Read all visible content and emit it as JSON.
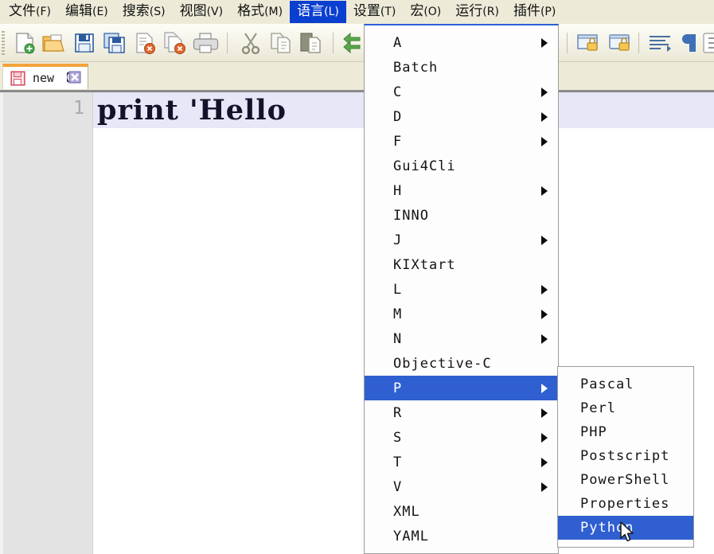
{
  "menubar": {
    "items": [
      {
        "label": "文件",
        "key": "(F)",
        "active": false,
        "name": "menu-file"
      },
      {
        "label": "编辑",
        "key": "(E)",
        "active": false,
        "name": "menu-edit"
      },
      {
        "label": "搜索",
        "key": "(S)",
        "active": false,
        "name": "menu-search"
      },
      {
        "label": "视图",
        "key": "(V)",
        "active": false,
        "name": "menu-view"
      },
      {
        "label": "格式",
        "key": "(M)",
        "active": false,
        "name": "menu-format"
      },
      {
        "label": "语言",
        "key": "(L)",
        "active": true,
        "name": "menu-language"
      },
      {
        "label": "设置",
        "key": "(T)",
        "active": false,
        "name": "menu-settings"
      },
      {
        "label": "宏",
        "key": "(O)",
        "active": false,
        "name": "menu-macro"
      },
      {
        "label": "运行",
        "key": "(R)",
        "active": false,
        "name": "menu-run"
      },
      {
        "label": "插件",
        "key": "(P)",
        "active": false,
        "name": "menu-plugins"
      }
    ]
  },
  "toolbar": {
    "icons": [
      "new-file-icon",
      "open-folder-icon",
      "save-icon",
      "save-all-icon",
      "close-file-icon",
      "close-all-icon",
      "print-icon",
      "cut-icon",
      "copy-icon",
      "paste-icon",
      "undo-icon",
      "zoom-in-lock-icon",
      "zoom-out-lock-icon",
      "word-wrap-icon",
      "show-paragraph-icon",
      "show-all-chars-icon"
    ]
  },
  "tabs": [
    {
      "label": "new",
      "icon": "unsaved-file-icon",
      "close": "close-tab-icon",
      "active": true
    }
  ],
  "editor": {
    "line_number": "1",
    "code": "print 'Hello"
  },
  "language_menu": {
    "items": [
      {
        "label": "A",
        "submenu": true
      },
      {
        "label": "Batch",
        "submenu": false
      },
      {
        "label": "C",
        "submenu": true
      },
      {
        "label": "D",
        "submenu": true
      },
      {
        "label": "F",
        "submenu": true
      },
      {
        "label": "Gui4Cli",
        "submenu": false
      },
      {
        "label": "H",
        "submenu": true
      },
      {
        "label": "INNO",
        "submenu": false
      },
      {
        "label": "J",
        "submenu": true
      },
      {
        "label": "KIXtart",
        "submenu": false
      },
      {
        "label": "L",
        "submenu": true
      },
      {
        "label": "M",
        "submenu": true
      },
      {
        "label": "N",
        "submenu": true
      },
      {
        "label": "Objective-C",
        "submenu": false
      },
      {
        "label": "P",
        "submenu": true,
        "selected": true
      },
      {
        "label": "R",
        "submenu": true
      },
      {
        "label": "S",
        "submenu": true
      },
      {
        "label": "T",
        "submenu": true
      },
      {
        "label": "V",
        "submenu": true
      },
      {
        "label": "XML",
        "submenu": false
      },
      {
        "label": "YAML",
        "submenu": false
      }
    ]
  },
  "p_submenu": {
    "items": [
      {
        "label": "Pascal",
        "selected": false
      },
      {
        "label": "Perl",
        "selected": false
      },
      {
        "label": "PHP",
        "selected": false
      },
      {
        "label": "Postscript",
        "selected": false
      },
      {
        "label": "PowerShell",
        "selected": false
      },
      {
        "label": "Properties",
        "selected": false
      },
      {
        "label": "Python",
        "selected": true
      }
    ]
  },
  "colors": {
    "menubar_bg": "#edebd8",
    "highlight_blue": "#2f5fd0",
    "menubar_active": "#0a3fd0",
    "tab_accent": "#f2a33c",
    "gutter_bg": "#e3e3e3",
    "current_line": "#e7e7f7"
  },
  "cursor": {
    "name": "mouse-pointer"
  }
}
